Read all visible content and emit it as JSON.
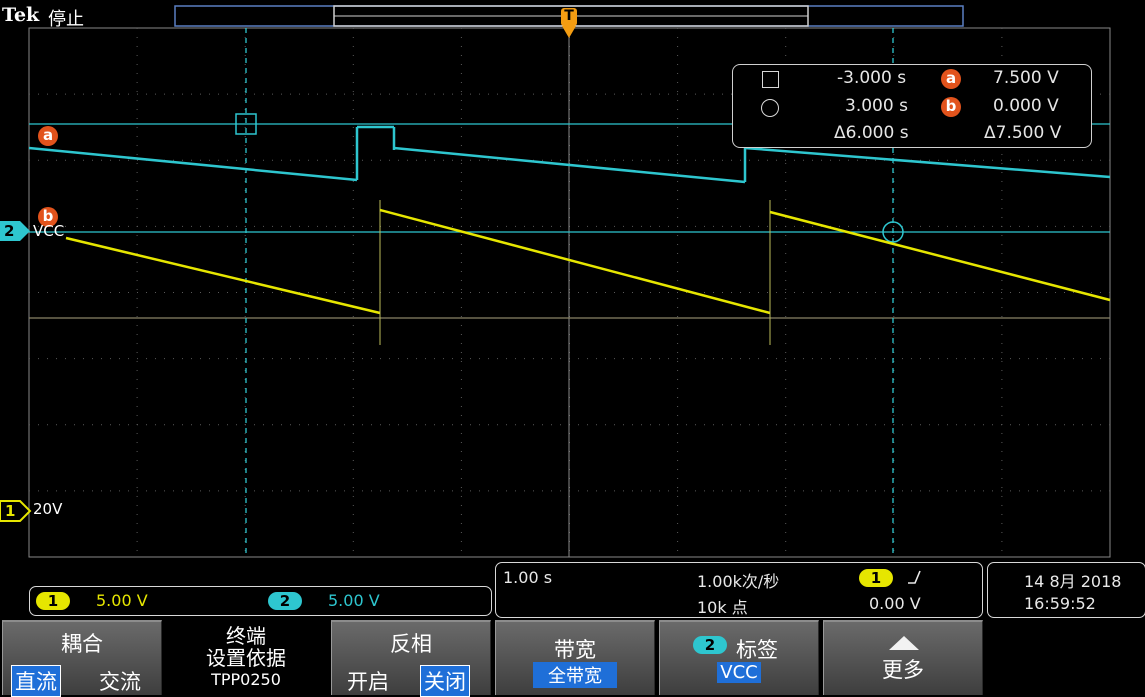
{
  "brand": "Tek",
  "acq_state": "停止",
  "colors": {
    "ch1": "#e6e600",
    "ch2": "#2ec6cf",
    "cursor_badge": "#e2531c",
    "trigger": "#f39c12",
    "select_blue": "#1f6fd8"
  },
  "trigger_marker": "T",
  "markers": {
    "cursor_a": "a",
    "cursor_b": "b",
    "ch2_marker": "2",
    "ch2_label": "VCC",
    "ch1_marker": "1",
    "ch1_label": "20V"
  },
  "cursor_readout": {
    "icon_a": "square-cursor-icon",
    "icon_b": "circle-cursor-icon",
    "t1": "-3.000 s",
    "t2": "3.000 s",
    "dt": "Δ6.000 s",
    "va": "7.500 V",
    "vb": "0.000 V",
    "dv": "Δ7.500 V",
    "badge_a": "a",
    "badge_b": "b"
  },
  "channels": {
    "ch1": {
      "num": "1",
      "scale": "5.00 V"
    },
    "ch2": {
      "num": "2",
      "scale": "5.00 V"
    }
  },
  "timebase": {
    "scale": "1.00 s",
    "rate": "1.00k次/秒",
    "record": "10k 点",
    "trig_ch": "1",
    "trig_slope_icon": "rising-edge-icon",
    "trig_level": "0.00 V"
  },
  "datetime": {
    "date": "14 8月 2018",
    "time": "16:59:52"
  },
  "softkeys": {
    "coupling": {
      "title": "耦合",
      "opt1": "直流",
      "opt2": "交流"
    },
    "termination": {
      "title1": "终端",
      "title2": "设置依据",
      "value": "TPP0250"
    },
    "invert": {
      "title": "反相",
      "opt1": "开启",
      "opt2": "关闭"
    },
    "bandwidth": {
      "title": "带宽",
      "value": "全带宽"
    },
    "label": {
      "badge": "2",
      "title": "标签",
      "value": "VCC"
    },
    "more": {
      "title": "更多"
    }
  }
}
